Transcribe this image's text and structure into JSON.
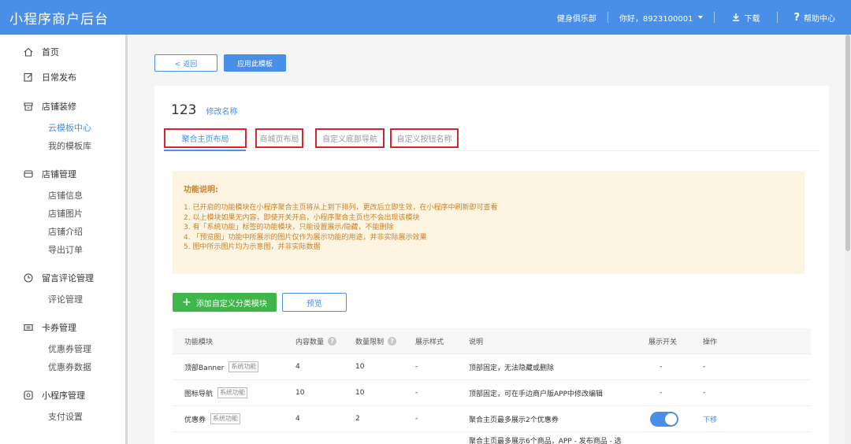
{
  "app": {
    "title": "小程序商户后台"
  },
  "topbar": {
    "store": "健身俱乐部",
    "greeting": "你好，8923100001",
    "download": "下载",
    "help": "帮助中心"
  },
  "sidebar": {
    "groups": [
      {
        "label": "首页",
        "icon": "home-icon",
        "items": []
      },
      {
        "label": "日常发布",
        "icon": "edit-icon",
        "items": []
      },
      {
        "label": "店铺装修",
        "icon": "shop-icon",
        "items": [
          "云模板中心",
          "我的模板库"
        ]
      },
      {
        "label": "店铺管理",
        "icon": "store-manage-icon",
        "items": [
          "店铺信息",
          "店铺图片",
          "店铺介绍",
          "导出订单"
        ]
      },
      {
        "label": "留言评论管理",
        "icon": "clock-icon",
        "items": [
          "评论管理"
        ]
      },
      {
        "label": "卡券管理",
        "icon": "coupon-icon",
        "items": [
          "优惠券管理",
          "优惠券数据"
        ]
      },
      {
        "label": "小程序管理",
        "icon": "miniprogram-icon",
        "items": [
          "支付设置"
        ]
      }
    ],
    "active_item": "云模板中心"
  },
  "actions": {
    "back": "< 返回",
    "apply": "应用此模板"
  },
  "template": {
    "name": "123",
    "rename": "修改名称"
  },
  "tabs": [
    "聚合主页布局",
    "商城页布局",
    "自定义底部导航",
    "自定义按钮名称"
  ],
  "notice": {
    "title": "功能说明:",
    "lines": [
      "1. 已开启的功能模块在小程序聚合主页将从上到下排列，更改后立即生效，在小程序中刷新即可查看",
      "2. 以上模块如果无内容，即使开关开启，小程序聚合主页也不会出现该模块",
      "3. 有「系统功能」标签的功能模块，只能设置展示/隐藏，不能删除",
      "4. 「预览图」功能中所展示的图片仅作为展示功能的用途，并非实际展示效果",
      "5. 图中所示图片均为示意图，并非实际数据"
    ]
  },
  "buttons": {
    "add": "添加自定义分类模块",
    "preview": "预览"
  },
  "table": {
    "headers": [
      "功能模块",
      "内容数量",
      "数量限制",
      "展示样式",
      "说明",
      "展示开关",
      "操作"
    ],
    "rows": [
      {
        "module": "顶部Banner",
        "tag": "系统功能",
        "count": "4",
        "limit": "10",
        "style": "-",
        "desc": "顶部固定，无法隐藏或删除",
        "switch": "-",
        "op": "-"
      },
      {
        "module": "图标导航",
        "tag": "系统功能",
        "count": "10",
        "limit": "10",
        "style": "-",
        "desc": "顶部固定，可在手边商户版APP中修改编辑",
        "switch": "-",
        "op": "-"
      },
      {
        "module": "优惠券",
        "tag": "系统功能",
        "count": "4",
        "limit": "2",
        "style": "-",
        "desc": "聚合主页最多展示2个优惠券",
        "switch": "on",
        "op": "下移"
      },
      {
        "module": "",
        "tag": "",
        "count": "",
        "limit": "",
        "style": "",
        "desc": "聚合主页最多展示6个商品，APP - 发布商品 - 选",
        "switch": "on",
        "op": ""
      }
    ]
  },
  "colors": {
    "primary": "#4a8fe7",
    "green": "#3fb64a",
    "highlight": "#d9232d",
    "notice_bg": "#fdf5e2",
    "notice_text": "#c8802b"
  }
}
